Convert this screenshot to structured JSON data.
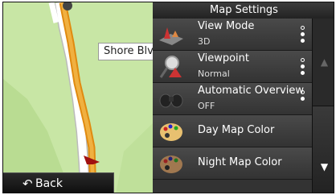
{
  "map": {
    "street_label": "Shore Blv",
    "back_label": "Back"
  },
  "panel": {
    "title": "Map Settings",
    "items": [
      {
        "label": "View Mode",
        "value": "3D",
        "icon": "view-mode-icon"
      },
      {
        "label": "Viewpoint",
        "value": "Normal",
        "icon": "viewpoint-icon"
      },
      {
        "label": "Automatic Overview",
        "value": "OFF",
        "icon": "binoculars-icon"
      },
      {
        "label": "Day Map Color",
        "icon": "palette-icon"
      },
      {
        "label": "Night Map Color",
        "icon": "palette-icon"
      }
    ]
  },
  "colors": {
    "map_background": "#c8e6a5",
    "route": "#f0a030",
    "panel_background": "#333333"
  }
}
